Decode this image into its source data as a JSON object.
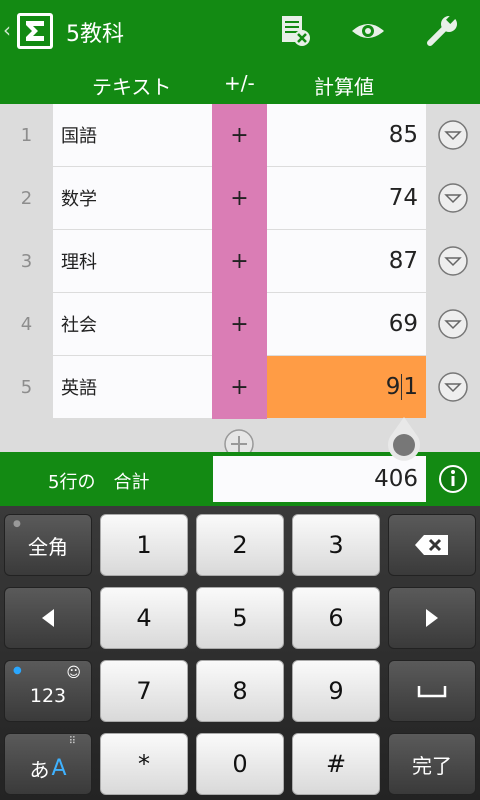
{
  "appbar": {
    "title": "5教科"
  },
  "columns": {
    "text": "テキスト",
    "sign": "+/-",
    "value": "計算値"
  },
  "rows": [
    {
      "num": "1",
      "text": "国語",
      "sign": "+",
      "value": "85"
    },
    {
      "num": "2",
      "text": "数学",
      "sign": "+",
      "value": "74"
    },
    {
      "num": "3",
      "text": "理科",
      "sign": "+",
      "value": "87"
    },
    {
      "num": "4",
      "text": "社会",
      "sign": "+",
      "value": "69"
    },
    {
      "num": "5",
      "text": "英語",
      "sign": "+",
      "value_before": "9",
      "value_after": "1"
    }
  ],
  "total": {
    "label": "5行の　合計",
    "value": "406"
  },
  "keyboard": {
    "zenkaku": "全角",
    "k1": "1",
    "k2": "2",
    "k3": "3",
    "k4": "4",
    "k5": "5",
    "k6": "6",
    "k7": "7",
    "k8": "8",
    "k9": "9",
    "kstar": "*",
    "k0": "0",
    "khash": "#",
    "num_mode": "123",
    "kana_mode": "あ",
    "kana_mode_alpha": "A",
    "done": "完了"
  },
  "colors": {
    "bar": "#138a13",
    "sign_cell": "#da7db5",
    "active_cell": "#ff9c45"
  }
}
